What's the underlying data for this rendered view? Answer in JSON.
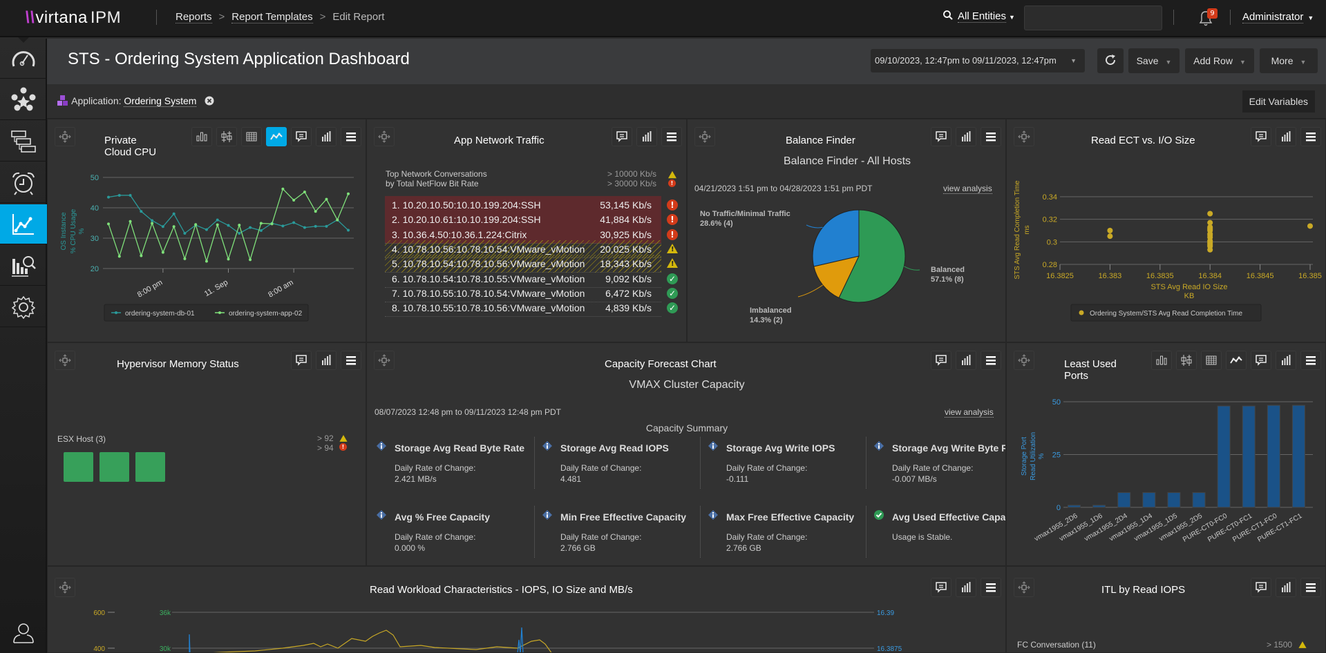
{
  "topbar": {
    "logo": "virtana",
    "logo_suffix": "IPM",
    "breadcrumb": [
      "Reports",
      "Report Templates",
      "Edit Report"
    ],
    "search_scope": "All Entities",
    "search_value": "",
    "notification_count": "9",
    "user": "Administrator"
  },
  "sidebar": {
    "items": [
      {
        "name": "dashboard",
        "icon": "gauge-icon"
      },
      {
        "name": "topology",
        "icon": "network-icon"
      },
      {
        "name": "hierarchy",
        "icon": "tree-icon"
      },
      {
        "name": "alarms",
        "icon": "alarm-clock-icon"
      },
      {
        "name": "reports",
        "icon": "line-chart-icon",
        "active": true
      },
      {
        "name": "analytics",
        "icon": "bar-search-icon"
      },
      {
        "name": "settings",
        "icon": "gear-icon"
      }
    ],
    "bottom": {
      "name": "profile",
      "icon": "user-icon"
    }
  },
  "header": {
    "title": "STS - Ordering System Application Dashboard",
    "date_range": "09/10/2023, 12:47pm to 09/11/2023, 12:47pm",
    "save_label": "Save",
    "add_row_label": "Add Row",
    "more_label": "More"
  },
  "variables": {
    "label": "Application:",
    "value": "Ordering System",
    "edit_label": "Edit Variables"
  },
  "panels": {
    "cpu": {
      "title": "Private\nCloud CPU"
    },
    "network": {
      "title": "App Network Traffic",
      "subtitle1": "Top Network Conversations",
      "subtitle2": "by Total NetFlow Bit Rate",
      "thr_warn": "> 10000 Kb/s",
      "thr_crit": "> 30000 Kb/s",
      "rows": [
        {
          "label": "1. 10.20.10.50:10.10.199.204:SSH",
          "value": "53,145 Kb/s",
          "status": "crit"
        },
        {
          "label": "2. 10.20.10.61:10.10.199.204:SSH",
          "value": "41,884 Kb/s",
          "status": "crit"
        },
        {
          "label": "3. 10.36.4.50:10.36.1.224:Citrix",
          "value": "30,925 Kb/s",
          "status": "crit"
        },
        {
          "label": "4. 10.78.10.56:10.78.10.54:VMware_vMotion",
          "value": "20,025 Kb/s",
          "status": "warn"
        },
        {
          "label": "5. 10.78.10.54:10.78.10.56:VMware_vMotion",
          "value": "18,343 Kb/s",
          "status": "warn"
        },
        {
          "label": "6. 10.78.10.54:10.78.10.55:VMware_vMotion",
          "value": "9,092 Kb/s",
          "status": "ok"
        },
        {
          "label": "7. 10.78.10.55:10.78.10.54:VMware_vMotion",
          "value": "6,472 Kb/s",
          "status": "ok"
        },
        {
          "label": "8. 10.78.10.55:10.78.10.56:VMware_vMotion",
          "value": "4,839 Kb/s",
          "status": "ok"
        }
      ]
    },
    "balance": {
      "title": "Balance Finder",
      "subtitle": "Balance Finder - All Hosts",
      "date": "04/21/2023 1:51 pm to 04/28/2023 1:51 pm PDT",
      "link": "view analysis"
    },
    "ect": {
      "title": "Read ECT vs. I/O Size"
    },
    "hyper": {
      "title": "Hypervisor Memory Status",
      "group": "ESX Host (3)",
      "thr_warn": "> 92",
      "thr_crit": "> 94",
      "hosts": [
        "ok",
        "ok",
        "ok"
      ]
    },
    "capacity": {
      "title": "Capacity Forecast Chart",
      "subtitle": "VMAX Cluster Capacity",
      "date": "08/07/2023 12:48 pm to 09/11/2023 12:48 pm PDT",
      "link": "view analysis",
      "summary": "Capacity Summary",
      "cells": [
        {
          "title": "Storage Avg Read Byte Rate",
          "l1": "Daily Rate of Change:",
          "l2": "2.421 MB/s",
          "icon": "info"
        },
        {
          "title": "Storage Avg Read IOPS",
          "l1": "Daily Rate of Change:",
          "l2": "4.481",
          "icon": "info"
        },
        {
          "title": "Storage Avg Write IOPS",
          "l1": "Daily Rate of Change:",
          "l2": "-0.111",
          "icon": "info"
        },
        {
          "title": "Storage Avg Write Byte Rate",
          "l1": "Daily Rate of Change:",
          "l2": "-0.007 MB/s",
          "icon": "info"
        },
        {
          "title": "Avg % Free Capacity",
          "l1": "Daily Rate of Change:",
          "l2": "0.000 %",
          "icon": "info"
        },
        {
          "title": "Min Free Effective Capacity",
          "l1": "Daily Rate of Change:",
          "l2": "2.766 GB",
          "icon": "info"
        },
        {
          "title": "Max Free Effective Capacity",
          "l1": "Daily Rate of Change:",
          "l2": "2.766 GB",
          "icon": "info"
        },
        {
          "title": "Avg Used Effective Capacity",
          "l1": "Usage is Stable.",
          "l2": "",
          "icon": "ok"
        }
      ]
    },
    "ports": {
      "title": "Least Used\nPorts"
    },
    "workload": {
      "title": "Read Workload Characteristics - IOPS, IO Size and MB/s"
    },
    "itl": {
      "title": "ITL by Read IOPS",
      "group": "FC Conversation (11)",
      "thr_warn": "> 1500"
    }
  },
  "chart_data": [
    {
      "id": "cpu",
      "type": "line",
      "title": "Private Cloud CPU",
      "ylabel": "OS Instance % CPU Usage %",
      "ylim": [
        20,
        50
      ],
      "yticks": [
        20,
        30,
        40,
        50
      ],
      "xticks": [
        "8:00 pm",
        "11. Sep",
        "8:00 am"
      ],
      "xtick_index": [
        5,
        11,
        17
      ],
      "legend": "bottom",
      "series": [
        {
          "name": "ordering-system-db-01",
          "color": "#2a9a9a",
          "values": [
            43.5,
            44.1,
            44.1,
            38.8,
            35.8,
            33.8,
            38.0,
            31.6,
            34.3,
            32.8,
            36.0,
            34.2,
            31.6,
            33.5,
            32.5,
            34.9,
            34.0,
            35.1,
            33.5,
            33.9,
            33.9,
            36.0,
            32.6
          ]
        },
        {
          "name": "ordering-system-app-02",
          "color": "#7fe07a",
          "values": [
            34.7,
            24.0,
            35.5,
            24.2,
            34.9,
            25.3,
            33.8,
            23.2,
            34.5,
            22.4,
            34.4,
            23.1,
            34.3,
            22.9,
            34.9,
            34.7,
            46.2,
            42.5,
            45.2,
            38.8,
            42.8,
            36.0,
            44.6
          ]
        }
      ]
    },
    {
      "id": "balance",
      "type": "pie",
      "title": "Balance Finder - All Hosts",
      "slices": [
        {
          "label": "Balanced",
          "percent": 57.1,
          "count": 8,
          "color": "#2e9a55"
        },
        {
          "label": "Imbalanced",
          "percent": 14.3,
          "count": 2,
          "color": "#e09b0c"
        },
        {
          "label": "No Traffic/Minimal Traffic",
          "percent": 28.6,
          "count": 4,
          "color": "#2180d0"
        }
      ]
    },
    {
      "id": "ect",
      "type": "scatter",
      "title": "Read ECT vs. I/O Size",
      "xlabel": "STS Avg Read IO Size KB",
      "ylabel": "STS Avg Read Completion Time ms",
      "xlim": [
        16.3825,
        16.385
      ],
      "ylim": [
        0.28,
        0.34
      ],
      "xticks": [
        "16.3825",
        "16.383",
        "16.3835",
        "16.384",
        "16.3845",
        "16.385"
      ],
      "yticks": [
        "0.28",
        "0.3",
        "0.32",
        "0.34"
      ],
      "legend": "Ordering System/STS Avg Read Completion Time",
      "color": "#c9a926",
      "points": [
        [
          16.383,
          0.31
        ],
        [
          16.383,
          0.305
        ],
        [
          16.384,
          0.325
        ],
        [
          16.384,
          0.317
        ],
        [
          16.384,
          0.313
        ],
        [
          16.384,
          0.312
        ],
        [
          16.384,
          0.311
        ],
        [
          16.384,
          0.31
        ],
        [
          16.384,
          0.307
        ],
        [
          16.384,
          0.306
        ],
        [
          16.384,
          0.304
        ],
        [
          16.384,
          0.301
        ],
        [
          16.384,
          0.3
        ],
        [
          16.384,
          0.299
        ],
        [
          16.384,
          0.298
        ],
        [
          16.384,
          0.297
        ],
        [
          16.384,
          0.296
        ],
        [
          16.384,
          0.293
        ],
        [
          16.385,
          0.314
        ]
      ]
    },
    {
      "id": "ports",
      "type": "bar",
      "title": "Least Used Ports",
      "ylabel": "Storage Port Read Utilization %",
      "ylim": [
        0,
        50
      ],
      "yticks": [
        0,
        25,
        50
      ],
      "categories": [
        "vmax1955_2D6",
        "vmax1955_1D6",
        "vmax1955_2D4",
        "vmax1955_1D4",
        "vmax1955_1D5",
        "vmax1955_2D5",
        "PURE-CT0-FC0",
        "PURE-CT0-FC1",
        "PURE-CT1-FC0",
        "PURE-CT1-FC1"
      ],
      "values": [
        1,
        1,
        7,
        7,
        7,
        7,
        48,
        48,
        48.3,
        48.3
      ]
    },
    {
      "id": "workload",
      "type": "line",
      "title": "Read Workload Characteristics - IOPS, IO Size and MB/s",
      "left_ticks": [
        "600",
        "400"
      ],
      "left2_ticks": [
        "36k",
        "30k"
      ],
      "right_ticks": [
        "16.39",
        "16.3875"
      ]
    }
  ]
}
